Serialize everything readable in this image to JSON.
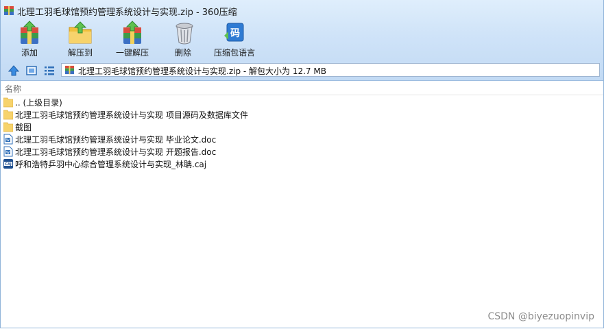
{
  "window": {
    "title": "北理工羽毛球馆预约管理系统设计与实现.zip - 360压缩"
  },
  "toolbar": {
    "items": [
      {
        "label": "添加",
        "icon": "add-archive-icon"
      },
      {
        "label": "解压到",
        "icon": "extract-to-icon"
      },
      {
        "label": "一键解压",
        "icon": "one-click-extract-icon"
      },
      {
        "label": "删除",
        "icon": "delete-trash-icon"
      },
      {
        "label": "压缩包语言",
        "icon": "archive-language-icon"
      }
    ],
    "language_glyph": "码"
  },
  "address": {
    "path": "北理工羽毛球馆预约管理系统设计与实现.zip - 解包大小为 12.7 MB"
  },
  "file_list": {
    "column_name": "名称",
    "rows": [
      {
        "name": ".. (上级目录)",
        "type": "folder"
      },
      {
        "name": "北理工羽毛球馆预约管理系统设计与实现 项目源码及数据库文件",
        "type": "folder"
      },
      {
        "name": "截图",
        "type": "folder"
      },
      {
        "name": "北理工羽毛球馆预约管理系统设计与实现 毕业论文.doc",
        "type": "doc"
      },
      {
        "name": "北理工羽毛球馆预约管理系统设计与实现 开题报告.doc",
        "type": "doc"
      },
      {
        "name": "呼和浩特乒羽中心综合管理系统设计与实现_林聃.caj",
        "type": "caj"
      }
    ]
  },
  "watermark": "CSDN @biyezuopinvip",
  "colors": {
    "chrome": "#cfe3f8",
    "folder": "#f7d36c",
    "accent": "#2f7bd3"
  }
}
